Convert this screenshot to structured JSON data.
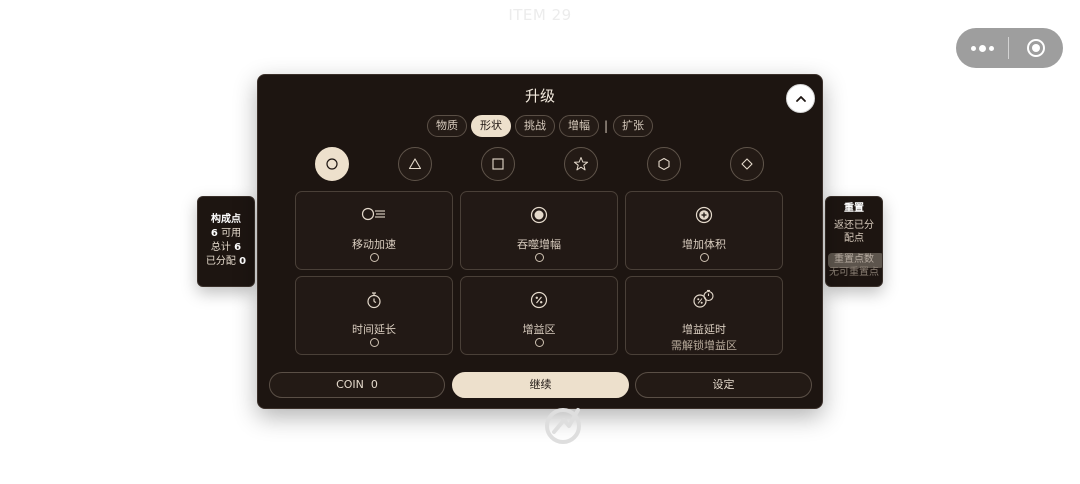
{
  "background": {
    "title": "ITEM 29"
  },
  "capsule": {
    "more_icon": "more-dots-icon",
    "close_icon": "miniprogram-close-icon"
  },
  "left_panel": {
    "title": "构成点",
    "available_value": "6",
    "available_label": "可用",
    "total_label": "总计",
    "total_value": "6",
    "allocated_label": "已分配",
    "allocated_value": "0"
  },
  "right_panel": {
    "title": "重置",
    "description": "返还已分配点",
    "reset_button_label": "重置点数",
    "no_points_text": "无可重置点"
  },
  "panel": {
    "title": "升级",
    "collapse_icon": "chevron-up-icon",
    "tabs": [
      {
        "label": "物质",
        "active": false
      },
      {
        "label": "形状",
        "active": true
      },
      {
        "label": "挑战",
        "active": false
      },
      {
        "label": "增幅",
        "active": false
      },
      {
        "label": "扩张",
        "active": false
      }
    ],
    "tab_separator": "|",
    "shapes": [
      {
        "icon": "circle-icon",
        "active": true
      },
      {
        "icon": "triangle-icon",
        "active": false
      },
      {
        "icon": "square-icon",
        "active": false
      },
      {
        "icon": "star-icon",
        "active": false
      },
      {
        "icon": "hexagon-icon",
        "active": false
      },
      {
        "icon": "diamond-icon",
        "active": false
      }
    ],
    "upgrades": [
      {
        "label": "移动加速",
        "icon": "speed-icon",
        "level_indicators": 1
      },
      {
        "label": "吞噬增幅",
        "icon": "target-icon",
        "level_indicators": 1
      },
      {
        "label": "增加体积",
        "icon": "plus-circle-icon",
        "level_indicators": 1
      },
      {
        "label": "时间延长",
        "icon": "stopwatch-icon",
        "level_indicators": 1
      },
      {
        "label": "增益区",
        "icon": "percent-icon",
        "level_indicators": 1
      },
      {
        "label": "增益延时",
        "icon": "percent-timer-icon",
        "note": "需解锁增益区",
        "level_indicators": 0
      }
    ],
    "coin_label": "COIN",
    "coin_value": "0",
    "continue_label": "继续",
    "settings_label": "设定"
  },
  "colors": {
    "panel_bg": "#1d1511",
    "accent": "#ede0cc",
    "text": "#d8ccbe"
  }
}
